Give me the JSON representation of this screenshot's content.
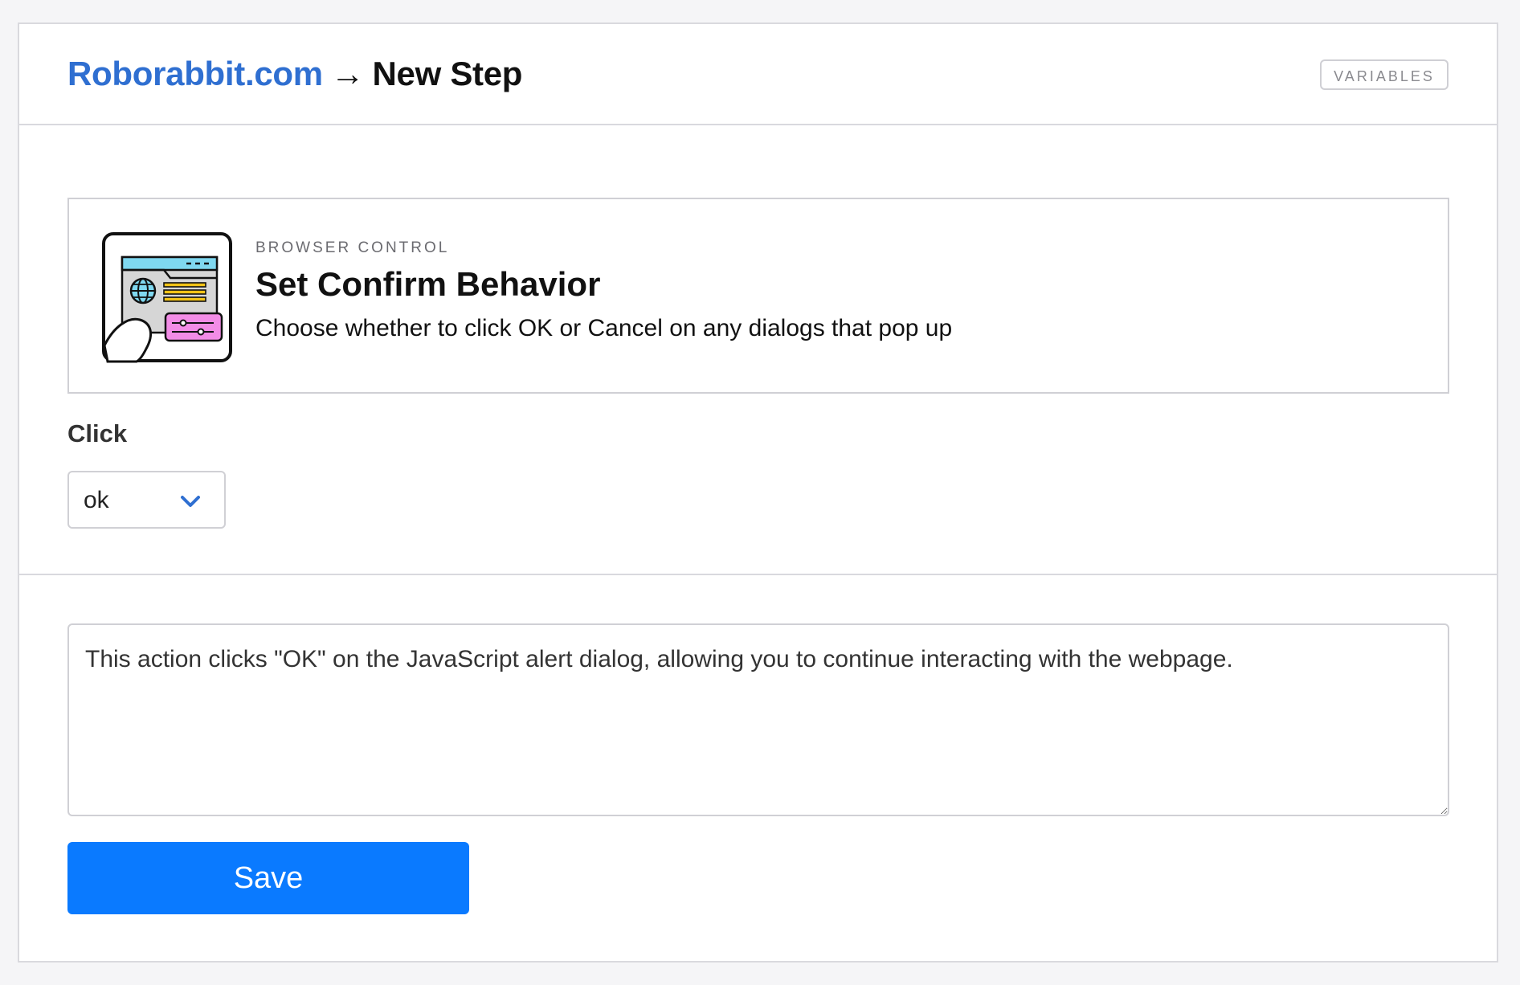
{
  "header": {
    "site_name": "Roborabbit.com",
    "arrow": "→",
    "step_title": "New Step",
    "variables_label": "VARIABLES"
  },
  "action": {
    "category": "BROWSER CONTROL",
    "title": "Set Confirm Behavior",
    "description": "Choose whether to click OK or Cancel on any dialogs that pop up",
    "icon": "browser-dialog-illustration-icon"
  },
  "form": {
    "click_label": "Click",
    "click_value": "ok",
    "note_text": "This action clicks \"OK\" on the JavaScript alert dialog, allowing you to continue interacting with the webpage.",
    "save_label": "Save"
  },
  "colors": {
    "brand_link": "#2f6fd1",
    "save_button": "#0a7aff",
    "chevron": "#2f6fd1",
    "icon_header": "#7fd8f0",
    "icon_lines": "#f2c318",
    "icon_panel": "#f28ce6"
  }
}
